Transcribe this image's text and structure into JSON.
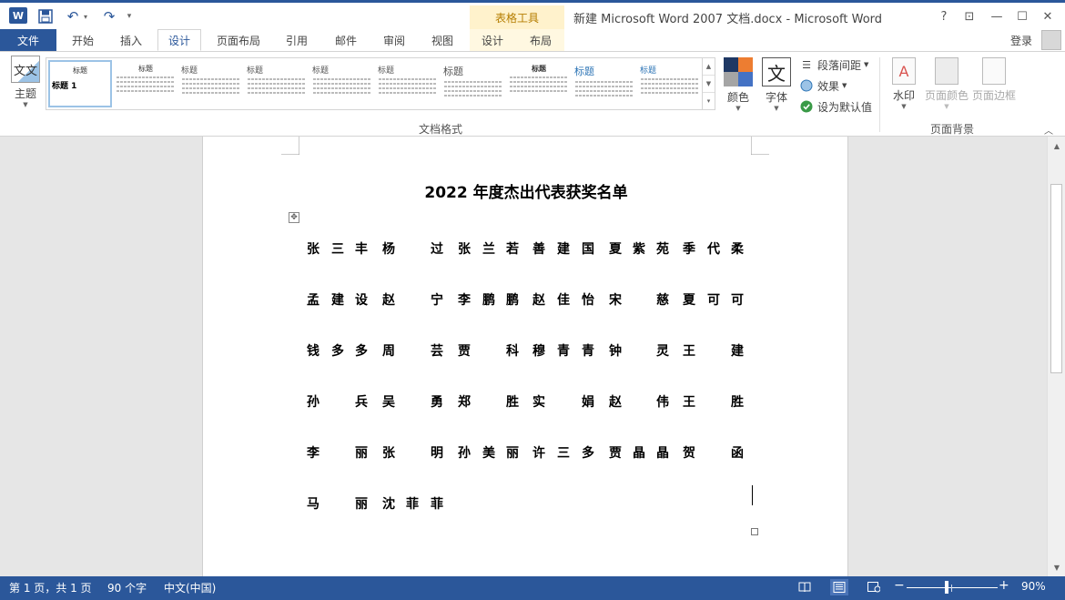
{
  "titlebar": {
    "app_icon": "W",
    "table_tools": "表格工具",
    "title": "新建 Microsoft Word 2007 文档.docx - Microsoft Word",
    "help": "?",
    "ribbon_display": "⊡",
    "minimize": "—",
    "maximize": "☐",
    "close": "✕"
  },
  "tabs": {
    "file": "文件",
    "items": [
      "开始",
      "插入",
      "设计",
      "页面布局",
      "引用",
      "邮件",
      "审阅",
      "视图",
      "设计",
      "布局"
    ],
    "login": "登录"
  },
  "ribbon": {
    "theme_label": "主题",
    "theme_icon_text": "文文",
    "gallery_titles": [
      "标题",
      "标题",
      "标题",
      "标题",
      "标题",
      "标题",
      "标题",
      "标题",
      "标题",
      "标题"
    ],
    "gallery_first_heading": "标题 1",
    "color_label": "颜色",
    "font_label": "字体",
    "font_icon_text": "文",
    "paragraph_spacing": "段落间距",
    "effects": "效果",
    "set_default": "设为默认值",
    "group_document_format": "文档格式",
    "watermark": "水印",
    "page_color": "页面颜色",
    "page_borders": "页面边框",
    "group_page_background": "页面背景",
    "theme_colors": [
      "#1f3864",
      "#ed7d31",
      "#a5a5a5",
      "#4472c4"
    ]
  },
  "document": {
    "heading": "2022 年度杰出代表获奖名单",
    "rows": [
      [
        "张",
        "三",
        "丰",
        "杨",
        "",
        "过",
        "张",
        "兰",
        "若",
        "善",
        "建",
        "国",
        "夏",
        "紫",
        "苑",
        "季",
        "代",
        "柔"
      ],
      [
        "孟",
        "建",
        "设",
        "赵",
        "",
        "宁",
        "李",
        "鹏",
        "鹏",
        "赵",
        "佳",
        "怡",
        "宋",
        "",
        "慈",
        "夏",
        "可",
        "可"
      ],
      [
        "钱",
        "多",
        "多",
        "周",
        "",
        "芸",
        "贾",
        "",
        "科",
        "穆",
        "青",
        "青",
        "钟",
        "",
        "灵",
        "王",
        "",
        "建"
      ],
      [
        "孙",
        "",
        "兵",
        "吴",
        "",
        "勇",
        "郑",
        "",
        "胜",
        "实",
        "",
        "娟",
        "赵",
        "",
        "伟",
        "王",
        "",
        "胜"
      ],
      [
        "李",
        "",
        "丽",
        "张",
        "",
        "明",
        "孙",
        "美",
        "丽",
        "许",
        "三",
        "多",
        "贾",
        "晶",
        "晶",
        "贺",
        "",
        "函"
      ],
      [
        "马",
        "",
        "丽",
        "沈",
        "菲",
        "菲",
        "",
        "",
        "",
        "",
        "",
        "",
        "",
        "",
        "",
        "",
        "",
        ""
      ]
    ]
  },
  "statusbar": {
    "page": "第 1 页，共 1 页",
    "words": "90 个字",
    "language": "中文(中国)",
    "zoom_minus": "−",
    "zoom_plus": "+",
    "zoom": "90%"
  }
}
